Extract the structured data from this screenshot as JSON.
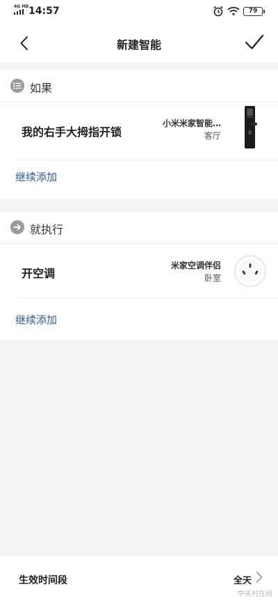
{
  "status_bar": {
    "network": "4G HD",
    "time": "14:57",
    "battery": "79",
    "icons": [
      "signal-icon",
      "alarm-icon",
      "wifi-icon",
      "battery-icon"
    ]
  },
  "nav": {
    "title": "新建智能",
    "back_icon": "back-arrow-icon",
    "confirm_icon": "checkmark-icon"
  },
  "if_section": {
    "label": "如果",
    "icon": "list-icon",
    "condition": {
      "title": "我的右手大拇指开锁",
      "device": "小米米家智能…",
      "room": "客厅",
      "device_icon": "smart-lock-icon"
    },
    "add_label": "继续添加"
  },
  "then_section": {
    "label": "就执行",
    "icon": "arrow-right-icon",
    "action": {
      "title": "开空调",
      "device": "米家空调伴侣",
      "room": "卧室",
      "device_icon": "ac-companion-plug-icon"
    },
    "add_label": "继续添加"
  },
  "footer": {
    "label": "生效时间段",
    "value": "全天",
    "chevron_icon": "chevron-right-icon"
  },
  "watermark": "中关村在线",
  "colors": {
    "accent_link": "#2f5a94",
    "background": "#f4f4f4",
    "card": "#ffffff",
    "section_icon": "#9a9a9a"
  }
}
